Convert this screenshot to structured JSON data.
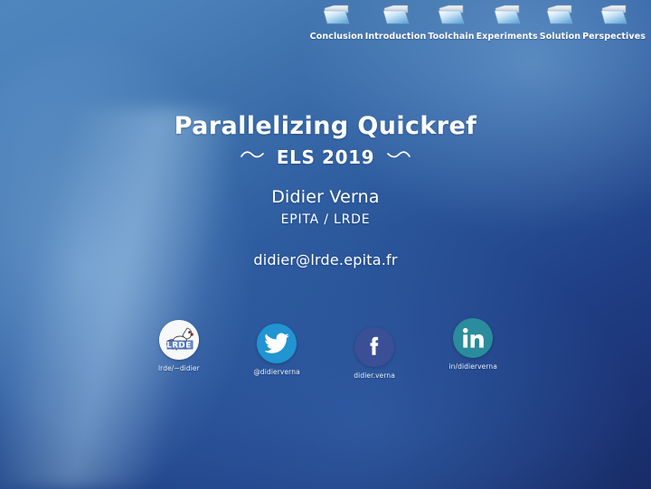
{
  "slide": {
    "background_colors": {
      "top_right": "#5a96c8",
      "top_left": "#3d70ab",
      "bottom": "#1d3070",
      "streak": "#badcf4"
    }
  },
  "navigation": {
    "items": [
      {
        "label": "Conclusion",
        "icon": "folder-icon"
      },
      {
        "label": "Introduction",
        "icon": "folder-icon"
      },
      {
        "label": "Toolchain",
        "icon": "folder-icon"
      },
      {
        "label": "Experiments",
        "icon": "folder-icon"
      },
      {
        "label": "Solution",
        "icon": "folder-icon"
      },
      {
        "label": "Perspectives",
        "icon": "folder-icon"
      }
    ]
  },
  "title": {
    "main": "Parallelizing Quickref",
    "subtitle": "ELS 2019",
    "ornament_left": "swash-left-icon",
    "ornament_right": "swash-right-icon"
  },
  "author": {
    "name": "Didier Verna",
    "affiliation": "EPITA / LRDE",
    "email": "didier@lrde.epita.fr"
  },
  "social": {
    "items": [
      {
        "icon": "lrde-logo-icon",
        "label": "lrde/~didier",
        "color": "#f2f4f7",
        "accent": "#3f5fa8"
      },
      {
        "icon": "twitter-bird-icon",
        "label": "@didierverna",
        "color": "#2194d2",
        "accent": "#ffffff"
      },
      {
        "icon": "facebook-f-icon",
        "label": "didier.verna",
        "color": "#3a4f96",
        "accent": "#ffffff"
      },
      {
        "icon": "linkedin-in-icon",
        "label": "in/didierverna",
        "color": "#2a8c9c",
        "accent": "#ffffff"
      }
    ]
  }
}
